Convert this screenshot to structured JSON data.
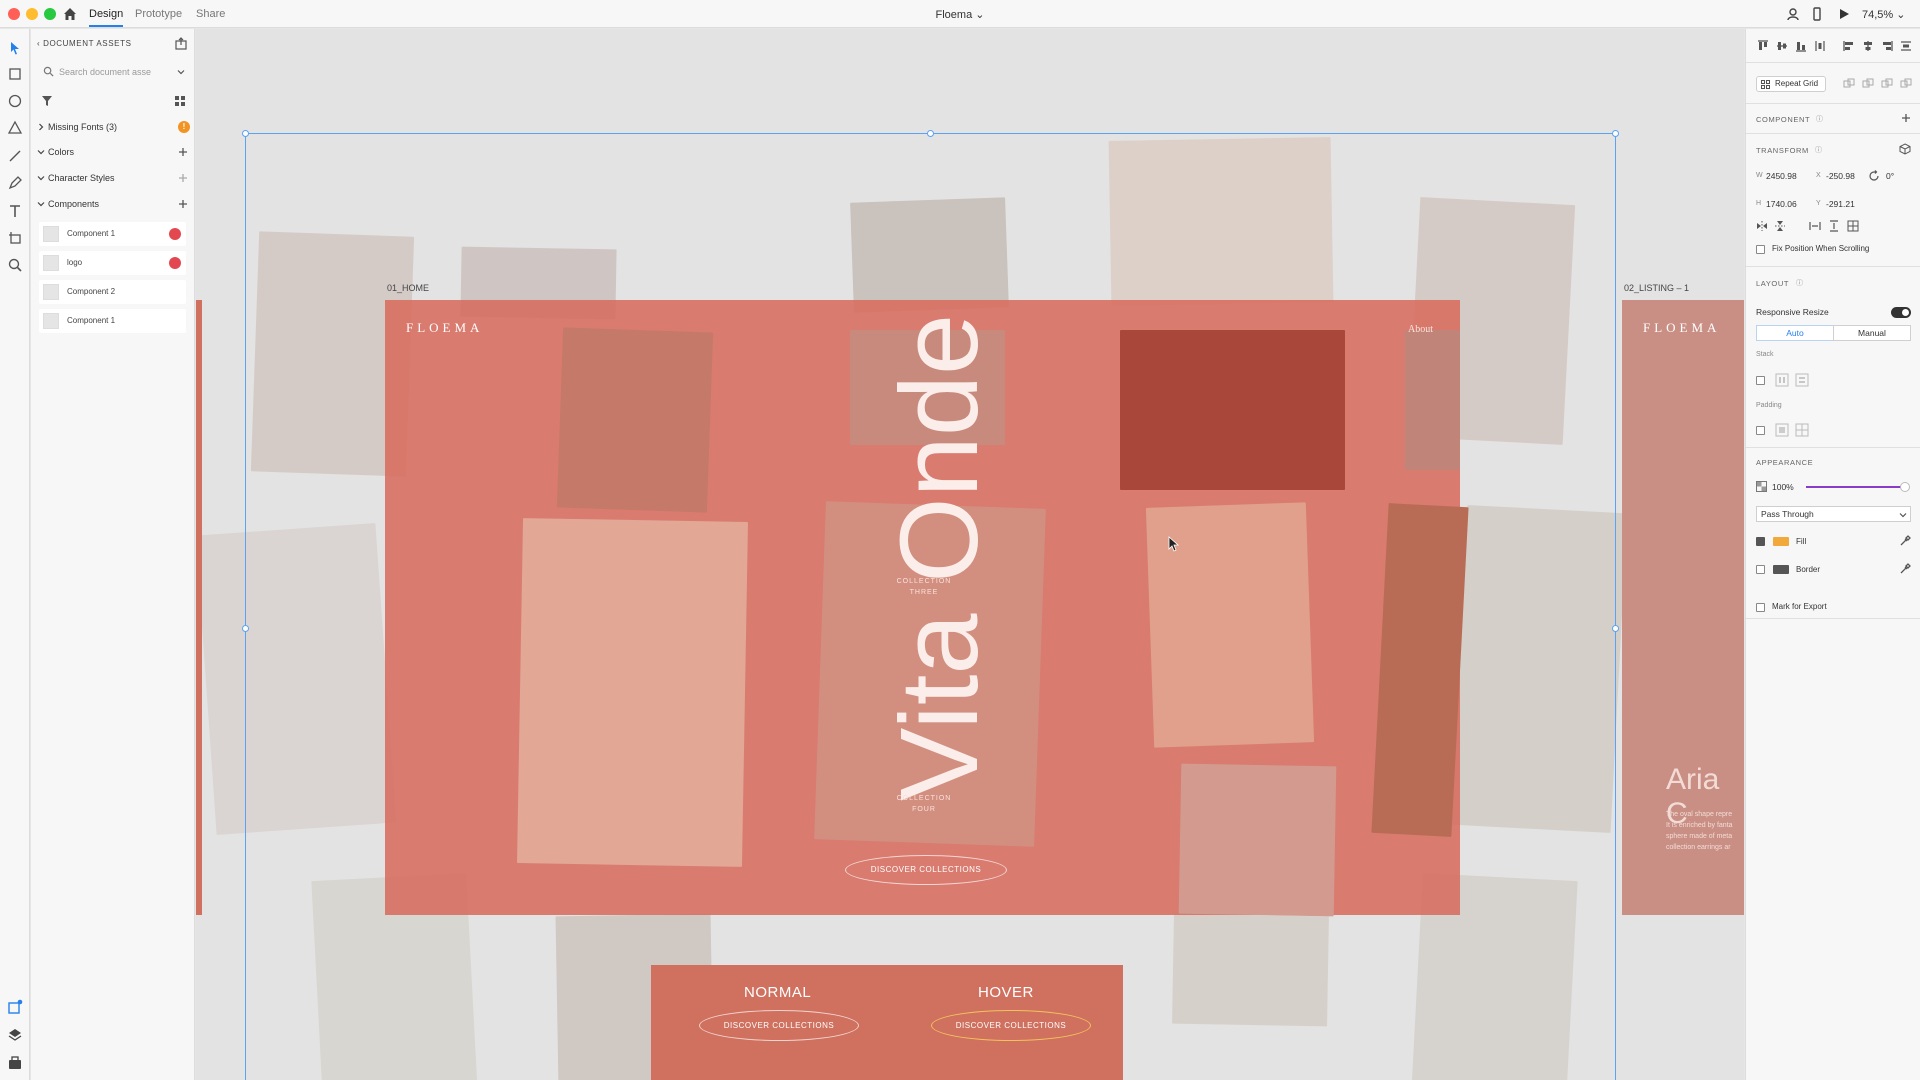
{
  "titlebar": {
    "tabs": [
      {
        "label": "Design",
        "active": true
      },
      {
        "label": "Prototype",
        "active": false
      },
      {
        "label": "Share",
        "active": false
      }
    ],
    "document_title": "Floema ⌄",
    "zoom": "74,5%  ⌄"
  },
  "toolbar": {
    "tools": [
      "select-tool-icon",
      "rectangle-tool-icon",
      "ellipse-tool-icon",
      "triangle-tool-icon",
      "line-tool-icon",
      "pen-tool-icon",
      "text-tool-icon",
      "artboard-tool-icon",
      "zoom-tool-icon"
    ],
    "bottom": [
      "plugins-icon",
      "layers-icon",
      "assets-icon"
    ]
  },
  "assets": {
    "header": "DOCUMENT ASSETS",
    "search_placeholder": "Search document asse",
    "sections": {
      "missing_fonts": "Missing Fonts (3)",
      "colors": "Colors",
      "character_styles": "Character Styles",
      "components": "Components"
    },
    "components": [
      {
        "name": "Component 1",
        "missing": true
      },
      {
        "name": "logo",
        "missing": true
      },
      {
        "name": "Component 2",
        "missing": false
      },
      {
        "name": "Component 1",
        "missing": false
      }
    ]
  },
  "canvas": {
    "artboard_home_label": "01_HOME",
    "artboard_listing_label": "02_LISTING – 1",
    "logo": "FLOEMA",
    "about": "About",
    "hero_title": "Vita Onde",
    "collection_three": "COLLECTION\nTHREE",
    "collection_four": "COLLECTION\nFOUR",
    "discover_button": "DISCOVER COLLECTIONS",
    "listing_logo": "FLOEMA",
    "listing_title": "Aria C",
    "listing_body": "The oval shape repre\nIt is enriched by fanta\nsphere made of meta\ncollection earrings ar",
    "states": {
      "normal_title": "NORMAL",
      "hover_title": "HOVER",
      "normal_button": "DISCOVER COLLECTIONS",
      "hover_button": "DISCOVER COLLECTIONS"
    },
    "accent_color": "#d7705f",
    "selection_color": "#5aa2f4"
  },
  "inspector": {
    "repeat_grid": "Repeat Grid",
    "component_section": "COMPONENT",
    "transform_section": "TRANSFORM",
    "w_label": "W",
    "w_value": "2450.98",
    "x_label": "X",
    "x_value": "-250.98",
    "rotation": "0°",
    "h_label": "H",
    "h_value": "1740.06",
    "y_label": "Y",
    "y_value": "-291.21",
    "fix_position": "Fix Position When Scrolling",
    "layout_section": "LAYOUT",
    "responsive_resize": "Responsive Resize",
    "responsive_on": true,
    "auto_label": "Auto",
    "manual_label": "Manual",
    "stack_label": "Stack",
    "padding_label": "Padding",
    "appearance_section": "APPEARANCE",
    "opacity": "100%",
    "opacity_fraction": 1.0,
    "blend_mode": "Pass Through",
    "fill_label": "Fill",
    "fill_checked": true,
    "fill_color": "#f2a93b",
    "border_label": "Border",
    "border_checked": false,
    "border_color": "#555555",
    "mark_for_export": "Mark for Export"
  }
}
